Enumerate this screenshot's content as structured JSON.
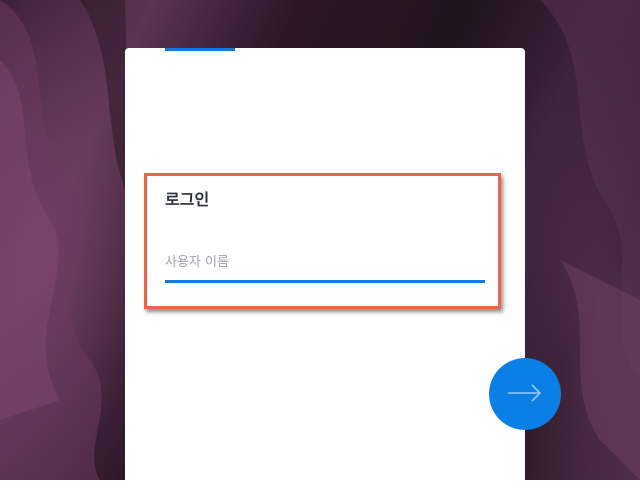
{
  "login_form": {
    "heading": "로그인",
    "username": {
      "value": "",
      "placeholder": "사용자 이름"
    },
    "next_button_icon": "arrow-right-icon"
  },
  "colors": {
    "accent": "#0e7be0",
    "highlight_border": "#f06150",
    "card_background": "#ffffff"
  }
}
